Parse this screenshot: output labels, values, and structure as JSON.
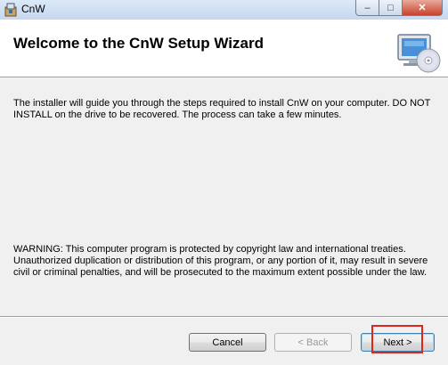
{
  "window": {
    "title": "CnW",
    "app_icon": "installer-icon",
    "controls": {
      "minimize": "–",
      "maximize": "□",
      "close": "✕"
    }
  },
  "banner": {
    "title": "Welcome to the CnW Setup Wizard",
    "icon": "computer-cd-icon"
  },
  "content": {
    "intro": "The installer will guide you through the steps required to install CnW on your computer.  DO NOT INSTALL on the drive to be recovered.  The process can take a few minutes.",
    "warning": "WARNING: This computer program is protected by copyright law and international treaties. Unauthorized duplication or distribution of this program, or any portion of it, may result in severe civil or criminal penalties, and will be prosecuted to the maximum extent possible under the law."
  },
  "buttons": {
    "cancel": "Cancel",
    "back": "< Back",
    "next": "Next >"
  },
  "colors": {
    "highlight": "#e0251b",
    "title_bar": "#c6d8ef"
  }
}
